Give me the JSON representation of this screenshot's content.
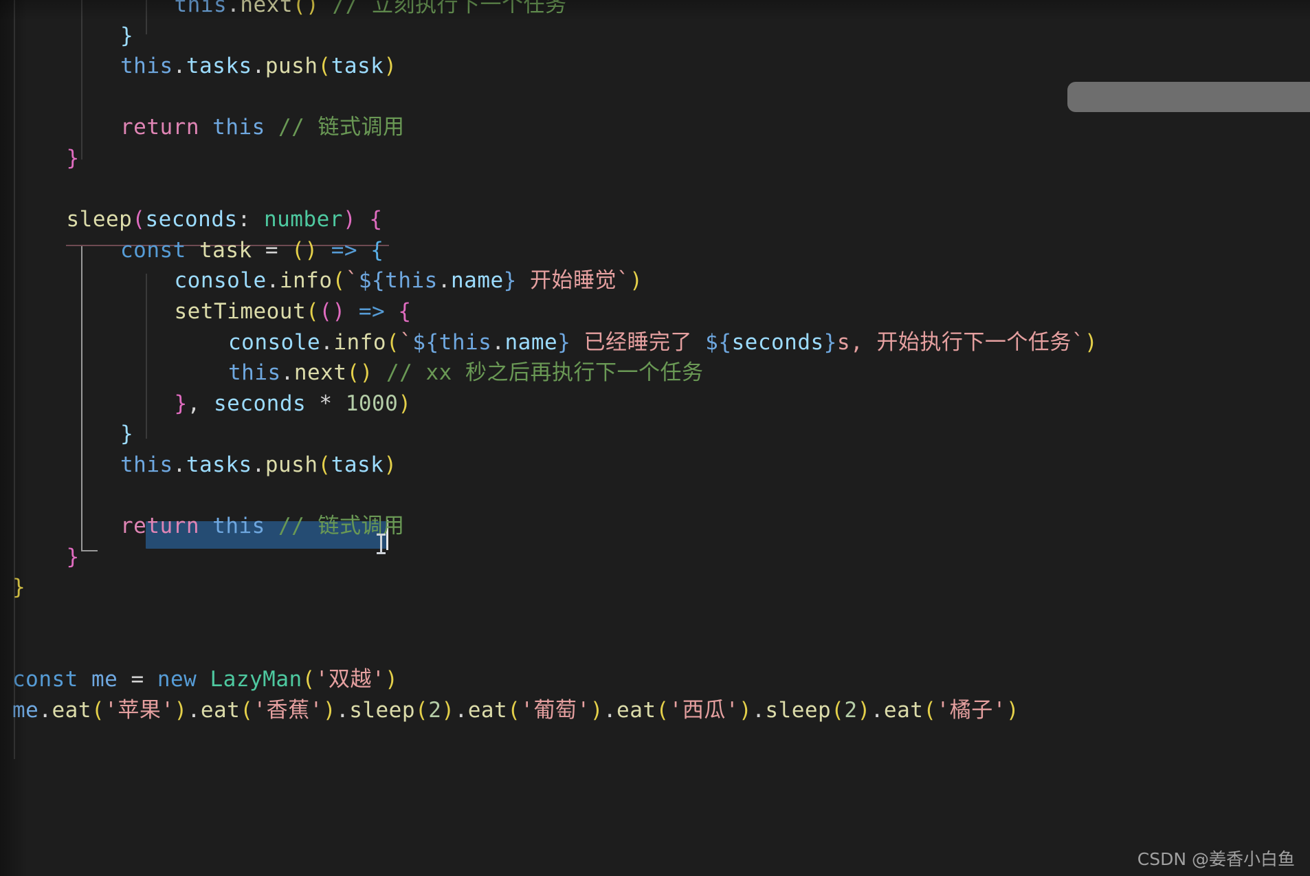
{
  "app": {
    "kind": "code-editor",
    "theme": "dark",
    "background": "#1d1d1d",
    "selection_color": "#264f78"
  },
  "watermark": {
    "text": "CSDN @姜香小白鱼"
  },
  "float_bar": {
    "label": ""
  },
  "code": {
    "language": "typescript",
    "lines": [
      {
        "indent": 3,
        "segments": [
          {
            "text": "this",
            "cls": "t-this"
          },
          {
            "text": ".",
            "cls": "t-punc"
          },
          {
            "text": "next",
            "cls": "t-fn"
          },
          {
            "text": "(",
            "cls": "t-paren-y"
          },
          {
            "text": ")",
            "cls": "t-paren-y"
          },
          {
            "text": " ",
            "cls": "t-plain"
          },
          {
            "text": "// 立刻执行下一个任务",
            "cls": "t-comment"
          }
        ]
      },
      {
        "indent": 2,
        "segments": [
          {
            "text": "}",
            "cls": "t-brace-b"
          }
        ]
      },
      {
        "indent": 2,
        "segments": [
          {
            "text": "this",
            "cls": "t-this"
          },
          {
            "text": ".",
            "cls": "t-punc"
          },
          {
            "text": "tasks",
            "cls": "t-prop"
          },
          {
            "text": ".",
            "cls": "t-punc"
          },
          {
            "text": "push",
            "cls": "t-fn"
          },
          {
            "text": "(",
            "cls": "t-paren-y"
          },
          {
            "text": "task",
            "cls": "t-prop"
          },
          {
            "text": ")",
            "cls": "t-paren-y"
          }
        ]
      },
      {
        "indent": 0,
        "segments": []
      },
      {
        "indent": 2,
        "segments": [
          {
            "text": "return",
            "cls": "t-kw"
          },
          {
            "text": " ",
            "cls": "t-plain"
          },
          {
            "text": "this",
            "cls": "t-this"
          },
          {
            "text": " ",
            "cls": "t-plain"
          },
          {
            "text": "// 链式调用",
            "cls": "t-comment"
          }
        ]
      },
      {
        "indent": 1,
        "segments": [
          {
            "text": "}",
            "cls": "t-paren-p"
          }
        ]
      },
      {
        "indent": 0,
        "segments": []
      },
      {
        "indent": 1,
        "segments": [
          {
            "text": "sleep",
            "cls": "t-fn"
          },
          {
            "text": "(",
            "cls": "t-paren-p"
          },
          {
            "text": "seconds",
            "cls": "t-prop"
          },
          {
            "text": ": ",
            "cls": "t-punc"
          },
          {
            "text": "number",
            "cls": "t-type"
          },
          {
            "text": ")",
            "cls": "t-paren-p"
          },
          {
            "text": " ",
            "cls": "t-plain"
          },
          {
            "text": "{",
            "cls": "t-paren-p"
          }
        ]
      },
      {
        "indent": 2,
        "segments": [
          {
            "text": "const",
            "cls": "t-op"
          },
          {
            "text": " ",
            "cls": "t-plain"
          },
          {
            "text": "task",
            "cls": "t-fn"
          },
          {
            "text": " ",
            "cls": "t-plain"
          },
          {
            "text": "=",
            "cls": "t-plain"
          },
          {
            "text": " ",
            "cls": "t-plain"
          },
          {
            "text": "(",
            "cls": "t-paren-y"
          },
          {
            "text": ")",
            "cls": "t-paren-y"
          },
          {
            "text": " ",
            "cls": "t-plain"
          },
          {
            "text": "=>",
            "cls": "t-arrow"
          },
          {
            "text": " ",
            "cls": "t-plain"
          },
          {
            "text": "{",
            "cls": "t-paren-b"
          }
        ]
      },
      {
        "indent": 3,
        "segments": [
          {
            "text": "console",
            "cls": "t-prop"
          },
          {
            "text": ".",
            "cls": "t-punc"
          },
          {
            "text": "info",
            "cls": "t-fn"
          },
          {
            "text": "(",
            "cls": "t-paren-y"
          },
          {
            "text": "`",
            "cls": "t-str"
          },
          {
            "text": "$",
            "cls": "t-this"
          },
          {
            "text": "{",
            "cls": "t-this"
          },
          {
            "text": "this",
            "cls": "t-this"
          },
          {
            "text": ".",
            "cls": "t-punc"
          },
          {
            "text": "name",
            "cls": "t-prop"
          },
          {
            "text": "}",
            "cls": "t-this"
          },
          {
            "text": " 开始睡觉",
            "cls": "t-str"
          },
          {
            "text": "`",
            "cls": "t-str"
          },
          {
            "text": ")",
            "cls": "t-paren-y"
          }
        ]
      },
      {
        "indent": 3,
        "segments": [
          {
            "text": "setTimeout",
            "cls": "t-fn"
          },
          {
            "text": "(",
            "cls": "t-paren-y"
          },
          {
            "text": "(",
            "cls": "t-paren-p"
          },
          {
            "text": ")",
            "cls": "t-paren-p"
          },
          {
            "text": " ",
            "cls": "t-plain"
          },
          {
            "text": "=>",
            "cls": "t-arrow"
          },
          {
            "text": " ",
            "cls": "t-plain"
          },
          {
            "text": "{",
            "cls": "t-paren-p"
          }
        ]
      },
      {
        "indent": 4,
        "segments": [
          {
            "text": "console",
            "cls": "t-prop"
          },
          {
            "text": ".",
            "cls": "t-punc"
          },
          {
            "text": "info",
            "cls": "t-fn"
          },
          {
            "text": "(",
            "cls": "t-paren-y"
          },
          {
            "text": "`",
            "cls": "t-str"
          },
          {
            "text": "$",
            "cls": "t-this"
          },
          {
            "text": "{",
            "cls": "t-this"
          },
          {
            "text": "this",
            "cls": "t-this"
          },
          {
            "text": ".",
            "cls": "t-punc"
          },
          {
            "text": "name",
            "cls": "t-prop"
          },
          {
            "text": "}",
            "cls": "t-this"
          },
          {
            "text": " 已经睡完了 ",
            "cls": "t-str"
          },
          {
            "text": "$",
            "cls": "t-this"
          },
          {
            "text": "{",
            "cls": "t-this"
          },
          {
            "text": "seconds",
            "cls": "t-prop"
          },
          {
            "text": "}",
            "cls": "t-this"
          },
          {
            "text": "s, 开始执行下一个任务",
            "cls": "t-str"
          },
          {
            "text": "`",
            "cls": "t-str"
          },
          {
            "text": ")",
            "cls": "t-paren-y"
          }
        ]
      },
      {
        "indent": 4,
        "segments": [
          {
            "text": "this",
            "cls": "t-this"
          },
          {
            "text": ".",
            "cls": "t-punc"
          },
          {
            "text": "next",
            "cls": "t-fn"
          },
          {
            "text": "(",
            "cls": "t-paren-y"
          },
          {
            "text": ")",
            "cls": "t-paren-y"
          },
          {
            "text": " ",
            "cls": "t-plain"
          },
          {
            "text": "// xx 秒之后再执行下一个任务",
            "cls": "t-comment"
          }
        ]
      },
      {
        "indent": 3,
        "segments": [
          {
            "text": "}",
            "cls": "t-paren-p"
          },
          {
            "text": ",",
            "cls": "t-punc"
          },
          {
            "text": " ",
            "cls": "t-plain"
          },
          {
            "text": "seconds",
            "cls": "t-prop"
          },
          {
            "text": " ",
            "cls": "t-plain"
          },
          {
            "text": "*",
            "cls": "t-plain"
          },
          {
            "text": " ",
            "cls": "t-plain"
          },
          {
            "text": "1000",
            "cls": "t-num"
          },
          {
            "text": ")",
            "cls": "t-paren-y"
          }
        ]
      },
      {
        "indent": 2,
        "segments": [
          {
            "text": "}",
            "cls": "t-brace-b"
          }
        ]
      },
      {
        "indent": 2,
        "segments": [
          {
            "text": "this",
            "cls": "t-this"
          },
          {
            "text": ".",
            "cls": "t-punc"
          },
          {
            "text": "tasks",
            "cls": "t-prop"
          },
          {
            "text": ".",
            "cls": "t-punc"
          },
          {
            "text": "push",
            "cls": "t-fn"
          },
          {
            "text": "(",
            "cls": "t-paren-y"
          },
          {
            "text": "task",
            "cls": "t-prop"
          },
          {
            "text": ")",
            "cls": "t-paren-y"
          }
        ]
      },
      {
        "indent": 0,
        "segments": []
      },
      {
        "indent": 2,
        "selected": true,
        "segments": [
          {
            "text": "return",
            "cls": "t-kw"
          },
          {
            "text": " ",
            "cls": "t-plain"
          },
          {
            "text": "this",
            "cls": "t-this"
          },
          {
            "text": " ",
            "cls": "t-plain"
          },
          {
            "text": "// 链式调用",
            "cls": "t-comment"
          }
        ]
      },
      {
        "indent": 1,
        "segments": [
          {
            "text": "}",
            "cls": "t-paren-p"
          }
        ]
      },
      {
        "indent": 0,
        "segments": [
          {
            "text": "}",
            "cls": "t-paren-y"
          }
        ]
      },
      {
        "indent": 0,
        "segments": []
      },
      {
        "indent": 0,
        "segments": []
      },
      {
        "indent": 0,
        "segments": [
          {
            "text": "const",
            "cls": "t-op"
          },
          {
            "text": " ",
            "cls": "t-plain"
          },
          {
            "text": "me",
            "cls": "t-this"
          },
          {
            "text": " ",
            "cls": "t-plain"
          },
          {
            "text": "=",
            "cls": "t-plain"
          },
          {
            "text": " ",
            "cls": "t-plain"
          },
          {
            "text": "new",
            "cls": "t-op"
          },
          {
            "text": " ",
            "cls": "t-plain"
          },
          {
            "text": "LazyMan",
            "cls": "t-type"
          },
          {
            "text": "(",
            "cls": "t-paren-y"
          },
          {
            "text": "'双越'",
            "cls": "t-str"
          },
          {
            "text": ")",
            "cls": "t-paren-y"
          }
        ]
      },
      {
        "indent": 0,
        "segments": [
          {
            "text": "me",
            "cls": "t-this"
          },
          {
            "text": ".",
            "cls": "t-punc"
          },
          {
            "text": "eat",
            "cls": "t-fn"
          },
          {
            "text": "(",
            "cls": "t-paren-y"
          },
          {
            "text": "'苹果'",
            "cls": "t-str"
          },
          {
            "text": ")",
            "cls": "t-paren-y"
          },
          {
            "text": ".",
            "cls": "t-punc"
          },
          {
            "text": "eat",
            "cls": "t-fn"
          },
          {
            "text": "(",
            "cls": "t-paren-y"
          },
          {
            "text": "'香蕉'",
            "cls": "t-str"
          },
          {
            "text": ")",
            "cls": "t-paren-y"
          },
          {
            "text": ".",
            "cls": "t-punc"
          },
          {
            "text": "sleep",
            "cls": "t-fn"
          },
          {
            "text": "(",
            "cls": "t-paren-y"
          },
          {
            "text": "2",
            "cls": "t-num"
          },
          {
            "text": ")",
            "cls": "t-paren-y"
          },
          {
            "text": ".",
            "cls": "t-punc"
          },
          {
            "text": "eat",
            "cls": "t-fn"
          },
          {
            "text": "(",
            "cls": "t-paren-y"
          },
          {
            "text": "'葡萄'",
            "cls": "t-str"
          },
          {
            "text": ")",
            "cls": "t-paren-y"
          },
          {
            "text": ".",
            "cls": "t-punc"
          },
          {
            "text": "eat",
            "cls": "t-fn"
          },
          {
            "text": "(",
            "cls": "t-paren-y"
          },
          {
            "text": "'西瓜'",
            "cls": "t-str"
          },
          {
            "text": ")",
            "cls": "t-paren-y"
          },
          {
            "text": ".",
            "cls": "t-punc"
          },
          {
            "text": "sleep",
            "cls": "t-fn"
          },
          {
            "text": "(",
            "cls": "t-paren-y"
          },
          {
            "text": "2",
            "cls": "t-num"
          },
          {
            "text": ")",
            "cls": "t-paren-y"
          },
          {
            "text": ".",
            "cls": "t-punc"
          },
          {
            "text": "eat",
            "cls": "t-fn"
          },
          {
            "text": "(",
            "cls": "t-paren-y"
          },
          {
            "text": "'橘子'",
            "cls": "t-str"
          },
          {
            "text": ")",
            "cls": "t-paren-y"
          }
        ]
      }
    ]
  }
}
